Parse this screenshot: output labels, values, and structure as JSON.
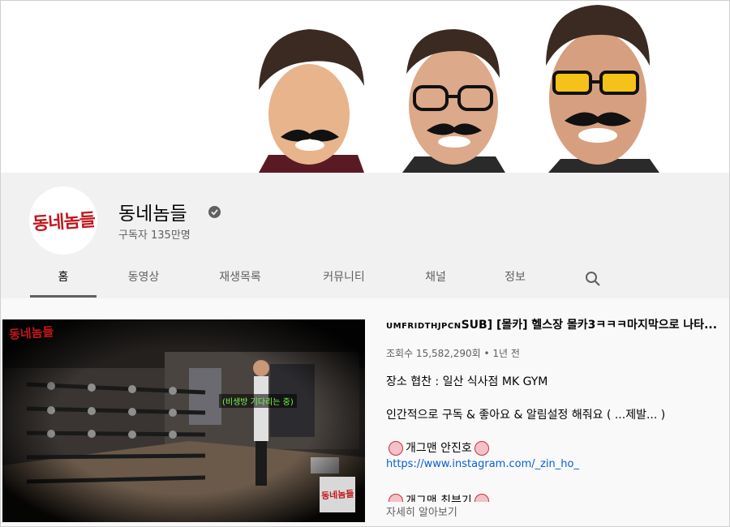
{
  "channel": {
    "name": "동네놈들",
    "subscribers": "구독자 135만명",
    "avatar_text": "동네놈들"
  },
  "tabs": [
    {
      "label": "홈",
      "active": true
    },
    {
      "label": "동영상"
    },
    {
      "label": "재생목록"
    },
    {
      "label": "커뮤니티"
    },
    {
      "label": "채널"
    },
    {
      "label": "정보"
    }
  ],
  "icons": {
    "search": "search-icon",
    "verified": "verified-check-icon"
  },
  "featured_video": {
    "title_code": "UMFRIDTHJPCN",
    "title": "SUB] [몰카] 헬스장 몰카3ㅋㅋㅋ마지막으로 나타...",
    "meta": "조회수 15,582,290회 • 1년 전",
    "watermark": "동네놈들",
    "caption": "(비생방 기다리는 중)",
    "description": [
      "장소 협찬 : 일산 식사점 MK GYM",
      "인간적으로 구독 & 좋아요 & 알림설정 해줘요 ( ...제발... )",
      "개그맨 안진호"
    ],
    "link": "https://www.instagram.com/_zin_ho_",
    "cut_line": "개그맨 최부기",
    "more_label": "자세히 알아보기"
  },
  "colors": {
    "accent_red": "#c4161c",
    "link_blue": "#065fd4",
    "header_bg": "#f1f1f1"
  }
}
